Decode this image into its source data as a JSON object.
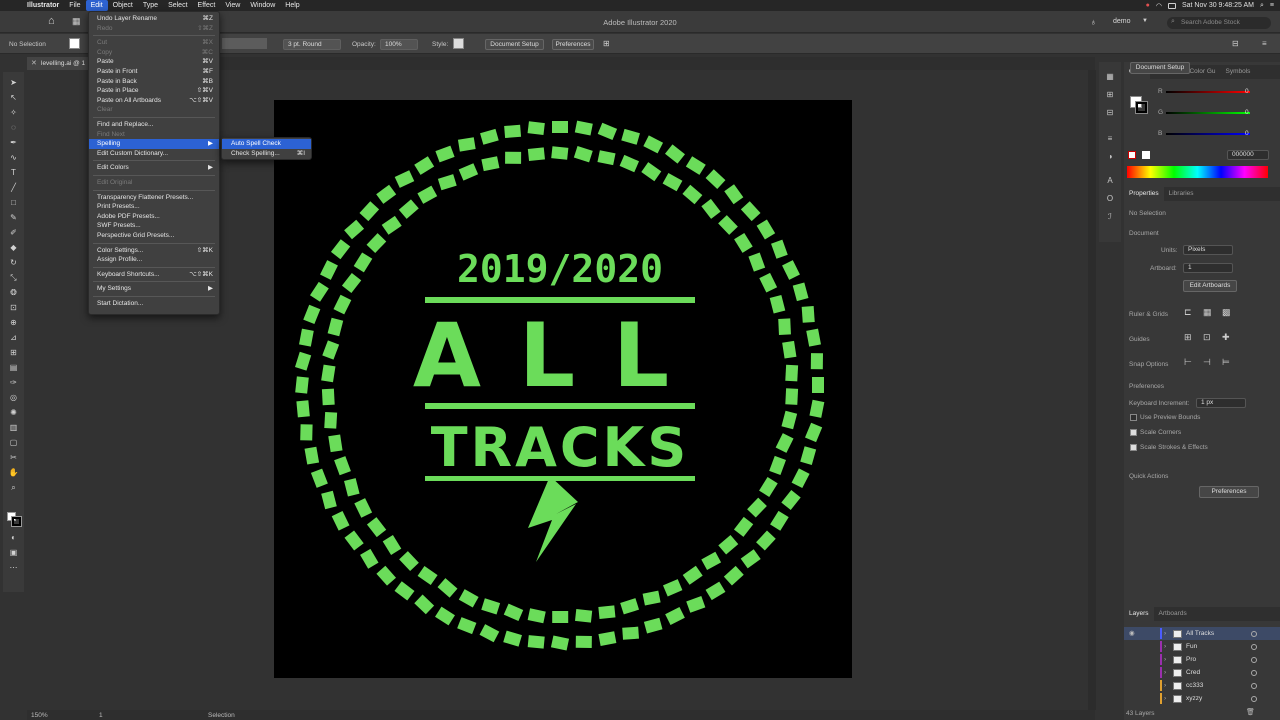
{
  "menubar": {
    "app": "Illustrator",
    "items": [
      "File",
      "Edit",
      "Object",
      "Type",
      "Select",
      "Effect",
      "View",
      "Window",
      "Help"
    ],
    "active": "Edit",
    "clock": "Sat Nov 30  9:48:25 AM"
  },
  "appbar": {
    "title": "Adobe Illustrator 2020",
    "workspace": "demo",
    "search_placeholder": "Search Adobe Stock"
  },
  "controlbar": {
    "selection": "No Selection",
    "stroke_weight": "3 pt. Round",
    "opacity_label": "Opacity:",
    "opacity_value": "100%",
    "style_label": "Style:",
    "document_setup": "Document Setup",
    "preferences": "Preferences"
  },
  "document_tab": {
    "name": "levelling.ai @ 1"
  },
  "edit_menu": [
    {
      "label": "Undo Layer Rename",
      "shortcut": "⌘Z",
      "enabled": true
    },
    {
      "label": "Redo",
      "shortcut": "⇧⌘Z",
      "enabled": false
    },
    {
      "separator": true
    },
    {
      "label": "Cut",
      "shortcut": "⌘X",
      "enabled": false
    },
    {
      "label": "Copy",
      "shortcut": "⌘C",
      "enabled": false
    },
    {
      "label": "Paste",
      "shortcut": "⌘V",
      "enabled": true
    },
    {
      "label": "Paste in Front",
      "shortcut": "⌘F",
      "enabled": true
    },
    {
      "label": "Paste in Back",
      "shortcut": "⌘B",
      "enabled": true
    },
    {
      "label": "Paste in Place",
      "shortcut": "⇧⌘V",
      "enabled": true
    },
    {
      "label": "Paste on All Artboards",
      "shortcut": "⌥⇧⌘V",
      "enabled": true
    },
    {
      "label": "Clear",
      "shortcut": "",
      "enabled": false
    },
    {
      "separator": true
    },
    {
      "label": "Find and Replace...",
      "shortcut": "",
      "enabled": true
    },
    {
      "label": "Find Next",
      "shortcut": "",
      "enabled": false
    },
    {
      "label": "Spelling",
      "shortcut": "▶",
      "enabled": true,
      "highlight": true
    },
    {
      "label": "Edit Custom Dictionary...",
      "shortcut": "",
      "enabled": true
    },
    {
      "separator": true
    },
    {
      "label": "Edit Colors",
      "shortcut": "▶",
      "enabled": true
    },
    {
      "separator": true
    },
    {
      "label": "Edit Original",
      "shortcut": "",
      "enabled": false
    },
    {
      "separator": true
    },
    {
      "label": "Transparency Flattener Presets...",
      "shortcut": "",
      "enabled": true
    },
    {
      "label": "Print Presets...",
      "shortcut": "",
      "enabled": true
    },
    {
      "label": "Adobe PDF Presets...",
      "shortcut": "",
      "enabled": true
    },
    {
      "label": "SWF Presets...",
      "shortcut": "",
      "enabled": true
    },
    {
      "label": "Perspective Grid Presets...",
      "shortcut": "",
      "enabled": true
    },
    {
      "separator": true
    },
    {
      "label": "Color Settings...",
      "shortcut": "⇧⌘K",
      "enabled": true
    },
    {
      "label": "Assign Profile...",
      "shortcut": "",
      "enabled": true
    },
    {
      "separator": true
    },
    {
      "label": "Keyboard Shortcuts...",
      "shortcut": "⌥⇧⌘K",
      "enabled": true
    },
    {
      "separator": true
    },
    {
      "label": "My Settings",
      "shortcut": "▶",
      "enabled": true
    },
    {
      "separator": true
    },
    {
      "label": "Start Dictation...",
      "shortcut": "",
      "enabled": true
    }
  ],
  "spelling_submenu": [
    {
      "label": "Auto Spell Check",
      "shortcut": "",
      "highlight": true
    },
    {
      "label": "Check Spelling...",
      "shortcut": "⌘I",
      "highlight": false
    }
  ],
  "artwork": {
    "year": "2019/2020",
    "word1": "ALL",
    "word2": "TRACKS",
    "green": "#6bdc5a",
    "background": "#000000"
  },
  "color_panel": {
    "tabs": [
      "Color",
      "Swatche",
      "Color Gu",
      "Symbols"
    ],
    "r": "0",
    "g": "0",
    "b": "0",
    "r_label": "R",
    "g_label": "G",
    "b_label": "B",
    "hex": "000000"
  },
  "properties_panel": {
    "tabs": [
      "Properties",
      "Libraries"
    ],
    "selection": "No Selection",
    "document_section": "Document",
    "units_label": "Units:",
    "units_value": "Pixels",
    "artboard_label": "Artboard:",
    "artboard_value": "1",
    "edit_artboards": "Edit Artboards",
    "ruler_grids": "Ruler & Grids",
    "guides": "Guides",
    "snap_options": "Snap Options",
    "preferences_section": "Preferences",
    "keyboard_increment_label": "Keyboard Increment:",
    "keyboard_increment_value": "1 px",
    "use_preview_bounds": "Use Preview Bounds",
    "scale_corners": "Scale Corners",
    "scale_strokes": "Scale Strokes & Effects",
    "quick_actions": "Quick Actions",
    "document_setup": "Document Setup",
    "preferences": "Preferences"
  },
  "layers_panel": {
    "tabs": [
      "Layers",
      "Artboards"
    ],
    "layers": [
      {
        "name": "All Tracks",
        "color": "#4b5cff",
        "selected": true
      },
      {
        "name": "Fun",
        "color": "#9b2fae",
        "selected": false
      },
      {
        "name": "Pro",
        "color": "#9b2fae",
        "selected": false
      },
      {
        "name": "Cred",
        "color": "#9b2fae",
        "selected": false
      },
      {
        "name": "cc333",
        "color": "#e0a030",
        "selected": false
      },
      {
        "name": "xyzzy",
        "color": "#e0a030",
        "selected": false
      }
    ],
    "count": "43 Layers"
  },
  "statusbar": {
    "zoom": "150%",
    "artboard": "1",
    "mode": "Selection"
  }
}
